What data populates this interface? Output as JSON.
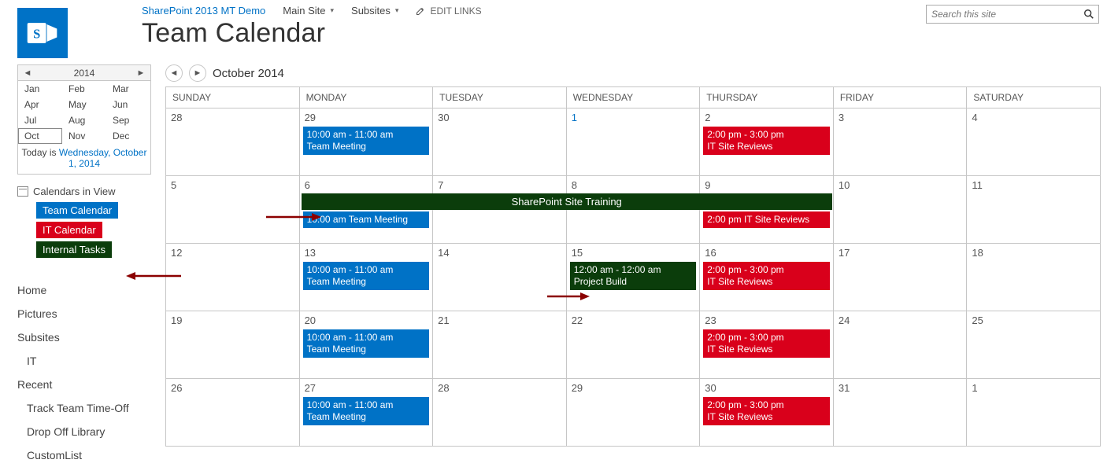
{
  "breadcrumb": {
    "site": "SharePoint 2013 MT Demo",
    "main": "Main Site",
    "subsites": "Subsites",
    "edit": "EDIT LINKS"
  },
  "page_title": "Team Calendar",
  "search": {
    "placeholder": "Search this site"
  },
  "mini_cal": {
    "year": "2014",
    "months": [
      "Jan",
      "Feb",
      "Mar",
      "Apr",
      "May",
      "Jun",
      "Jul",
      "Aug",
      "Sep",
      "Oct",
      "Nov",
      "Dec"
    ],
    "selected_index": 9,
    "today_prefix": "Today is ",
    "today_link": "Wednesday, October 1, 2014"
  },
  "calendars_in_view": {
    "title": "Calendars in View",
    "items": [
      {
        "label": "Team Calendar",
        "color": "blue"
      },
      {
        "label": "IT Calendar",
        "color": "red"
      },
      {
        "label": "Internal Tasks",
        "color": "green"
      }
    ]
  },
  "nav": [
    {
      "label": "Home",
      "indent": 0
    },
    {
      "label": "Pictures",
      "indent": 0
    },
    {
      "label": "Subsites",
      "indent": 0
    },
    {
      "label": "IT",
      "indent": 1
    },
    {
      "label": "Recent",
      "indent": 0
    },
    {
      "label": "Track Team Time-Off",
      "indent": 1
    },
    {
      "label": "Drop Off Library",
      "indent": 1
    },
    {
      "label": "CustomList",
      "indent": 1
    }
  ],
  "calendar": {
    "title": "October 2014",
    "day_headers": [
      "SUNDAY",
      "MONDAY",
      "TUESDAY",
      "WEDNESDAY",
      "THURSDAY",
      "FRIDAY",
      "SATURDAY"
    ],
    "weeks": [
      {
        "days": [
          "28",
          "29",
          "30",
          "1",
          "2",
          "3",
          "4"
        ],
        "today_col": 3,
        "events": [
          {
            "col": 1,
            "color": "blue",
            "l1": "10:00 am - 11:00 am",
            "l2": "Team Meeting"
          },
          {
            "col": 4,
            "color": "red",
            "l1": "2:00 pm - 3:00 pm",
            "l2": "IT Site Reviews"
          }
        ],
        "span": null
      },
      {
        "days": [
          "5",
          "6",
          "7",
          "8",
          "9",
          "10",
          "11"
        ],
        "today_col": -1,
        "events": [
          {
            "col": 1,
            "color": "blue",
            "single": "10:00 am Team Meeting",
            "push": true
          },
          {
            "col": 4,
            "color": "red",
            "single": "2:00 pm IT Site Reviews",
            "push": true
          }
        ],
        "span": {
          "label": "SharePoint Site Training"
        }
      },
      {
        "days": [
          "12",
          "13",
          "14",
          "15",
          "16",
          "17",
          "18"
        ],
        "today_col": -1,
        "events": [
          {
            "col": 1,
            "color": "blue",
            "l1": "10:00 am - 11:00 am",
            "l2": "Team Meeting"
          },
          {
            "col": 3,
            "color": "green",
            "l1": "12:00 am - 12:00 am",
            "l2": "Project Build"
          },
          {
            "col": 4,
            "color": "red",
            "l1": "2:00 pm - 3:00 pm",
            "l2": "IT Site Reviews"
          }
        ],
        "span": null
      },
      {
        "days": [
          "19",
          "20",
          "21",
          "22",
          "23",
          "24",
          "25"
        ],
        "today_col": -1,
        "events": [
          {
            "col": 1,
            "color": "blue",
            "l1": "10:00 am - 11:00 am",
            "l2": "Team Meeting"
          },
          {
            "col": 4,
            "color": "red",
            "l1": "2:00 pm - 3:00 pm",
            "l2": "IT Site Reviews"
          }
        ],
        "span": null
      },
      {
        "days": [
          "26",
          "27",
          "28",
          "29",
          "30",
          "31",
          "1"
        ],
        "today_col": -1,
        "events": [
          {
            "col": 1,
            "color": "blue",
            "l1": "10:00 am - 11:00 am",
            "l2": "Team Meeting"
          },
          {
            "col": 4,
            "color": "red",
            "l1": "2:00 pm - 3:00 pm",
            "l2": "IT Site Reviews"
          }
        ],
        "span": null
      }
    ]
  }
}
